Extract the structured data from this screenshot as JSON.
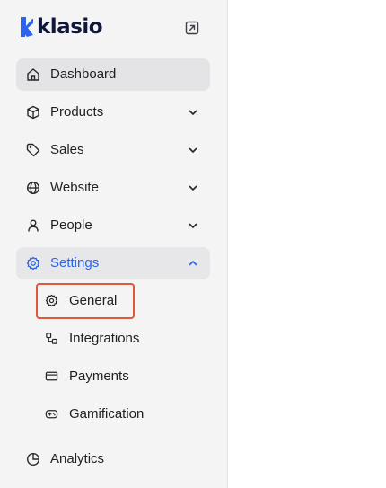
{
  "brand": {
    "name": "klasio",
    "color": "#10183a",
    "mark_color": "#2d63e8"
  },
  "header": {
    "collapse_icon": "external-link-square-icon"
  },
  "nav": {
    "items": [
      {
        "label": "Dashboard",
        "icon": "home-icon",
        "state": "active"
      },
      {
        "label": "Products",
        "icon": "box-icon",
        "chevron": "down"
      },
      {
        "label": "Sales",
        "icon": "tag-icon",
        "chevron": "down"
      },
      {
        "label": "Website",
        "icon": "globe-icon",
        "chevron": "down"
      },
      {
        "label": "People",
        "icon": "person-icon",
        "chevron": "down"
      },
      {
        "label": "Settings",
        "icon": "gear-icon",
        "chevron": "up",
        "state": "expanded"
      }
    ],
    "settings_children": [
      {
        "label": "General",
        "icon": "gear-icon",
        "highlighted": true
      },
      {
        "label": "Integrations",
        "icon": "integrations-icon"
      },
      {
        "label": "Payments",
        "icon": "credit-card-icon"
      },
      {
        "label": "Gamification",
        "icon": "gamepad-icon"
      }
    ],
    "bottom": [
      {
        "label": "Analytics",
        "icon": "pie-chart-icon"
      }
    ]
  },
  "colors": {
    "sidebar_bg": "#f4f4f5",
    "active_bg": "#e4e4e7",
    "accent": "#2d63e8",
    "highlight_border": "#e2573b",
    "text": "#1f1f23"
  }
}
